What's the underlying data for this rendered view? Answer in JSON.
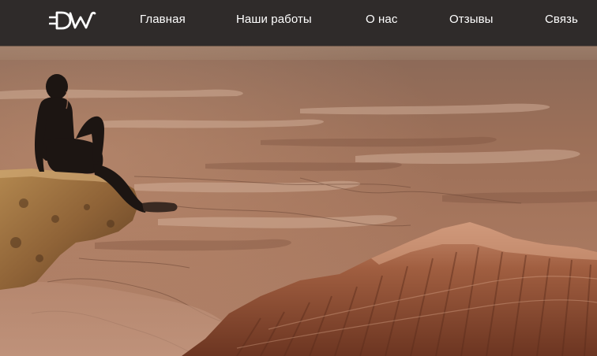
{
  "header": {
    "logo_text": "DW",
    "nav": [
      {
        "label": "Главная"
      },
      {
        "label": "Наши работы"
      },
      {
        "label": "О нас"
      },
      {
        "label": "Отзывы"
      },
      {
        "label": "Связь"
      }
    ]
  },
  "hero": {
    "image": "desert-canyon-person-sitting-on-cliff"
  },
  "colors": {
    "navbar_bg": "#2f2b2a",
    "nav_text": "#ffffff"
  }
}
